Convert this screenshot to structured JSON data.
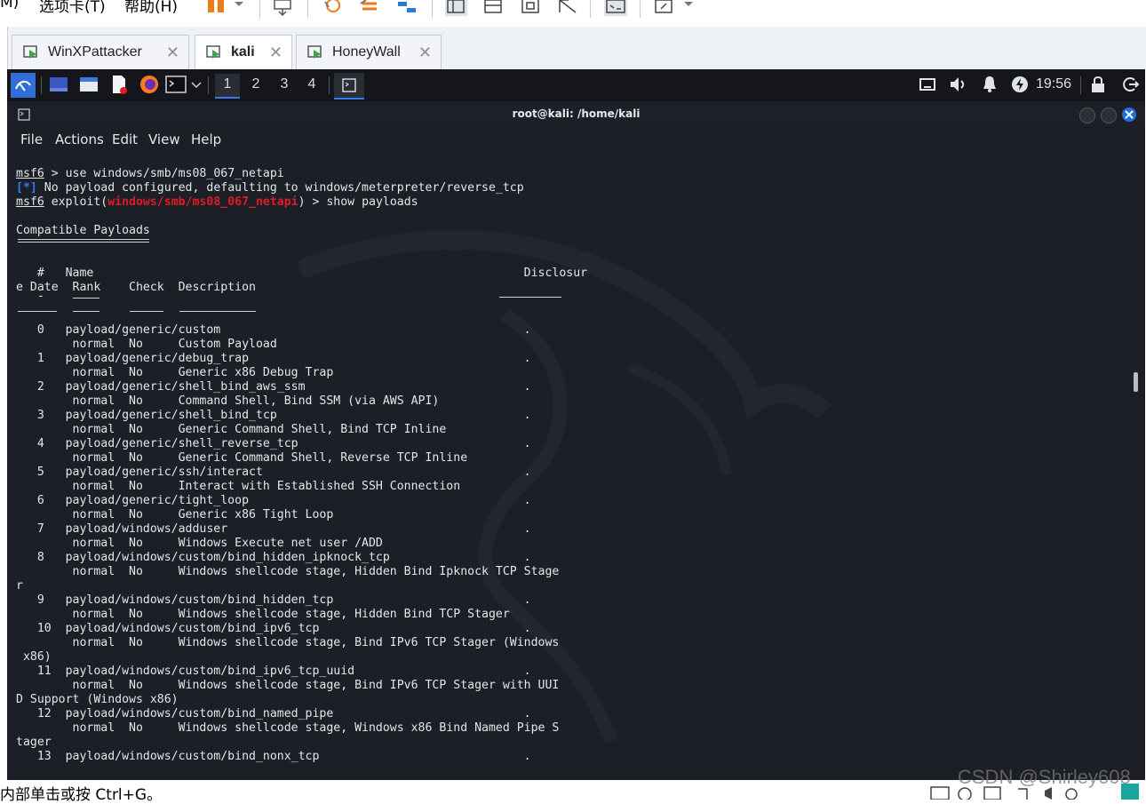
{
  "vm": {
    "menu": [
      "M)",
      "选项卡(T)",
      "帮助(H)"
    ],
    "tabs": [
      {
        "label": "WinXPattacker",
        "active": false
      },
      {
        "label": "kali",
        "active": true
      },
      {
        "label": "HoneyWall",
        "active": false
      }
    ],
    "status_text": "内部单击或按 Ctrl+G。",
    "watermark": "CSDN @Shirley608"
  },
  "panel": {
    "workspaces": [
      "1",
      "2",
      "3",
      "4"
    ],
    "active_workspace": "1",
    "clock": "19:56"
  },
  "terminal": {
    "title": "root@kali: /home/kali",
    "menu": [
      "File",
      "Actions",
      "Edit",
      "View",
      "Help"
    ],
    "cmd1": {
      "prompt": "msf6",
      "text": " > use windows/smb/ms08_067_netapi"
    },
    "info": {
      "tag": "[*]",
      "text": " No payload configured, defaulting to windows/meterpreter/reverse_tcp"
    },
    "cmd2": {
      "prompt": "msf6",
      "pre": " exploit(",
      "module": "windows/smb/ms08_067_netapi",
      "post": ") > show payloads"
    },
    "section_title": "Compatible Payloads",
    "header1": "   #   Name                                                             Disclosur",
    "header2": "e Date  Rank    Check  Description",
    "header3": "   -",
    "lines": [
      "   0   payload/generic/custom                                           .",
      "        normal  No     Custom Payload",
      "   1   payload/generic/debug_trap                                       .",
      "        normal  No     Generic x86 Debug Trap",
      "   2   payload/generic/shell_bind_aws_ssm                               .",
      "        normal  No     Command Shell, Bind SSM (via AWS API)",
      "   3   payload/generic/shell_bind_tcp                                   .",
      "        normal  No     Generic Command Shell, Bind TCP Inline",
      "   4   payload/generic/shell_reverse_tcp                                .",
      "        normal  No     Generic Command Shell, Reverse TCP Inline",
      "   5   payload/generic/ssh/interact                                     .",
      "        normal  No     Interact with Established SSH Connection",
      "   6   payload/generic/tight_loop                                       .",
      "        normal  No     Generic x86 Tight Loop",
      "   7   payload/windows/adduser                                          .",
      "        normal  No     Windows Execute net user /ADD",
      "   8   payload/windows/custom/bind_hidden_ipknock_tcp                   .",
      "        normal  No     Windows shellcode stage, Hidden Bind Ipknock TCP Stage",
      "r",
      "   9   payload/windows/custom/bind_hidden_tcp                           .",
      "        normal  No     Windows shellcode stage, Hidden Bind TCP Stager",
      "   10  payload/windows/custom/bind_ipv6_tcp                             .",
      "        normal  No     Windows shellcode stage, Bind IPv6 TCP Stager (Windows",
      " x86)",
      "   11  payload/windows/custom/bind_ipv6_tcp_uuid                        .",
      "        normal  No     Windows shellcode stage, Bind IPv6 TCP Stager with UUI",
      "D Support (Windows x86)",
      "   12  payload/windows/custom/bind_named_pipe                           .",
      "        normal  No     Windows shellcode stage, Windows x86 Bind Named Pipe S",
      "tager",
      "   13  payload/windows/custom/bind_nonx_tcp                             ."
    ]
  },
  "colors": {
    "terminal_bg": "#1c1f26",
    "panel_bg": "#14161b",
    "accent_blue": "#367bf0",
    "info_blue": "#2e7cff",
    "module_red": "#e01b24",
    "close_button": "#1f6fe0"
  }
}
